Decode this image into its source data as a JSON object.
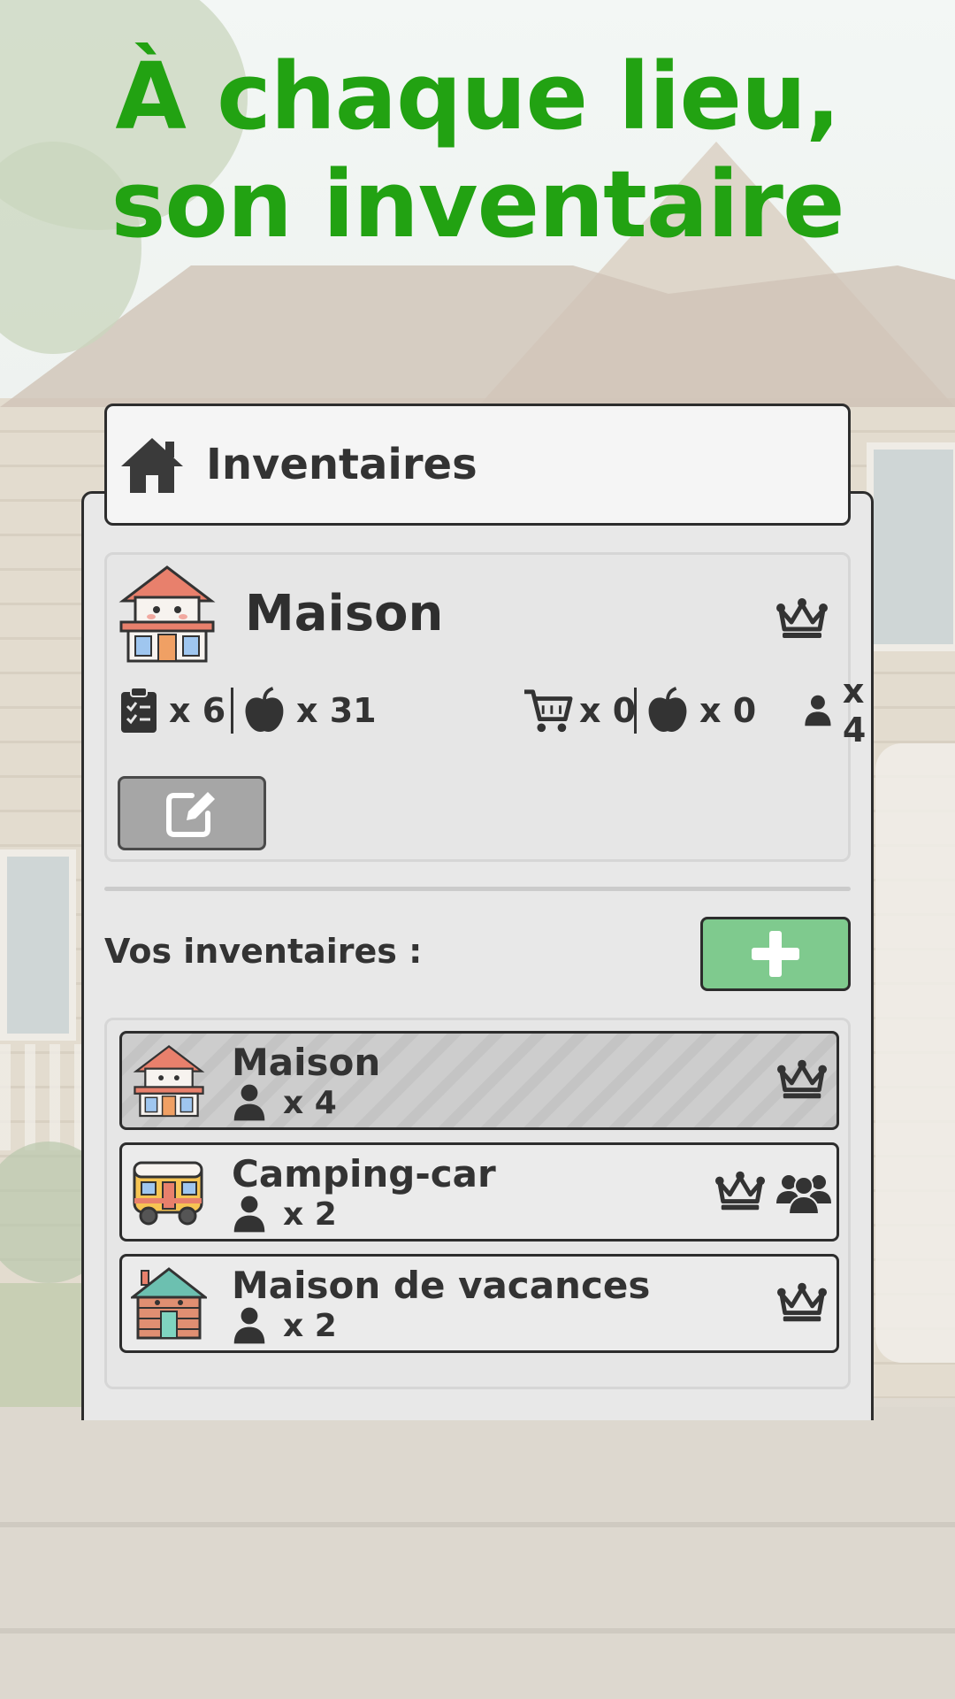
{
  "headline": {
    "line1": "À chaque lieu,",
    "line2": "son inventaire"
  },
  "header": {
    "title": "Inventaires",
    "icon": "home-icon"
  },
  "current_inventory": {
    "name": "Maison",
    "stats": {
      "tasks": "x 6",
      "items": "x 31",
      "cart": "x 0",
      "cart_items": "x 0",
      "members": "x 4"
    }
  },
  "inventories_section": {
    "label": "Vos inventaires :"
  },
  "inventories": [
    {
      "name": "Maison",
      "members": "x 4",
      "selected": true,
      "owner": true,
      "shared": false
    },
    {
      "name": "Camping-car",
      "members": "x 2",
      "selected": false,
      "owner": true,
      "shared": true
    },
    {
      "name": "Maison de vacances",
      "members": "x 2",
      "selected": false,
      "owner": true,
      "shared": false
    }
  ],
  "colors": {
    "headline": "#22a212",
    "add_button": "#7fca8e",
    "edit_button": "#a6a6a6"
  }
}
